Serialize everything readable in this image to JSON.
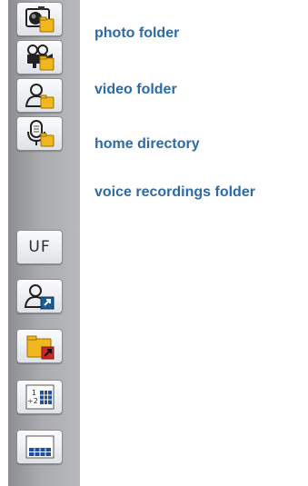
{
  "toolbar": {
    "buttons": [
      {
        "icon": "camera-folder-icon"
      },
      {
        "icon": "video-camera-folder-icon"
      },
      {
        "icon": "person-folder-icon"
      },
      {
        "icon": "microphone-folder-icon"
      },
      {
        "icon": "uf-text-icon",
        "text": "UF"
      },
      {
        "icon": "person-shortcut-icon"
      },
      {
        "icon": "folder-shortcut-icon"
      },
      {
        "icon": "fraction-grid-icon"
      },
      {
        "icon": "keyboard-grid-icon"
      }
    ]
  },
  "labels": {
    "photo": "photo folder",
    "video": "video folder",
    "home": "home directory",
    "voice": "voice recordings folder"
  },
  "icon_text": {
    "fraction": "1",
    "fraction_sign": "÷2"
  },
  "colors": {
    "label": "#2e6aa6",
    "folder": "#f2b71f",
    "shortcut_blue": "#1b5b96",
    "shortcut_red": "#c8282d",
    "grid_blue": "#1e4f9c"
  }
}
